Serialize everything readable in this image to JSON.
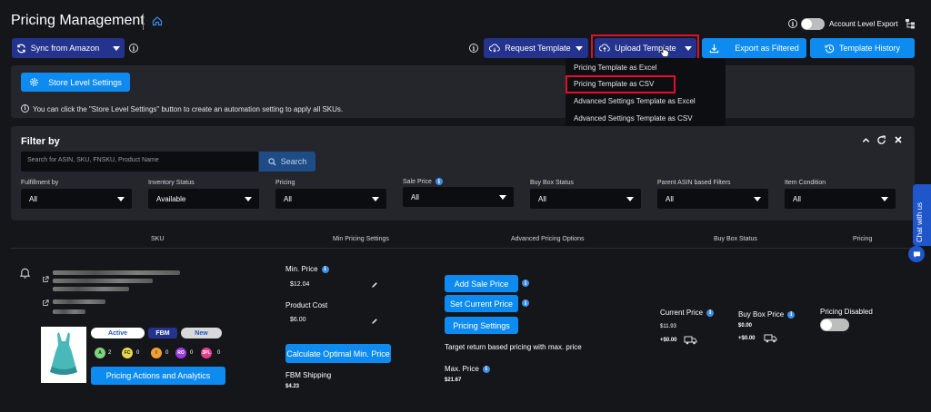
{
  "header": {
    "title": "Pricing Management",
    "account_export_label": "Account Level Export"
  },
  "toolbar": {
    "sync_label": "Sync from Amazon",
    "request_template_label": "Request Template",
    "upload_template_label": "Upload Template",
    "export_filtered_label": "Export as Filtered",
    "template_history_label": "Template History"
  },
  "upload_menu": {
    "items": [
      "Pricing Template as Excel",
      "Pricing Template as CSV",
      "Advanced Settings Template as Excel",
      "Advanced Settings Template as CSV"
    ]
  },
  "store_settings": {
    "button_label": "Store Level Settings",
    "info_text": "You can click the \"Store Level Settings\" button to create an automation setting to apply all SKUs."
  },
  "filter": {
    "title": "Filter by",
    "search_placeholder": "Search for ASIN, SKU, FNSKU, Product Name",
    "search_button": "Search",
    "fields": [
      {
        "label": "Fulfillment by",
        "value": "All"
      },
      {
        "label": "Inventory Status",
        "value": "Available"
      },
      {
        "label": "Pricing",
        "value": "All"
      },
      {
        "label": "Sale Price",
        "value": "All"
      },
      {
        "label": "Buy Box Status",
        "value": "All"
      },
      {
        "label": "Parent ASIN based Filters",
        "value": "All"
      },
      {
        "label": "Item Condition",
        "value": "All"
      }
    ]
  },
  "table": {
    "headers": [
      "SKU",
      "Min Pricing Settings",
      "Advanced Pricing Options",
      "Buy Box Status",
      "Pricing"
    ]
  },
  "row": {
    "badges": {
      "active": "Active",
      "fbm": "FBM",
      "new": "New"
    },
    "counters": [
      {
        "code": "A",
        "count": "2",
        "color": "#7ed37e"
      },
      {
        "code": "FC",
        "count": "0",
        "color": "#e8d84a"
      },
      {
        "code": "I",
        "count": "0",
        "color": "#f0a030"
      },
      {
        "code": "RO",
        "count": "0",
        "color": "#9a3ce0"
      },
      {
        "code": "3PL",
        "count": "0",
        "color": "#e43c8c"
      }
    ],
    "actions_button": "Pricing Actions and Analytics",
    "min_price_label": "Min. Price",
    "min_price_value": "$12.04",
    "product_cost_label": "Product Cost",
    "product_cost_value": "$6.00",
    "calc_button": "Calculate Optimal Min. Price",
    "fbm_shipping_label": "FBM Shipping",
    "fbm_shipping_value": "$4.23",
    "add_sale_button": "Add Sale Price",
    "set_current_button": "Set Current Price",
    "pricing_settings_button": "Pricing Settings",
    "target_text": "Target return based pricing with max. price",
    "max_price_label": "Max. Price",
    "max_price_value": "$21.67",
    "current_price_label": "Current Price",
    "current_price_value": "$11.93",
    "current_ship": "+$0.00",
    "buybox_price_label": "Buy Box Price",
    "buybox_price_value": "$0.00",
    "buybox_ship": "+$0.00",
    "pricing_disabled_label": "Pricing Disabled"
  },
  "side": {
    "chat_label": "Chat with us"
  }
}
